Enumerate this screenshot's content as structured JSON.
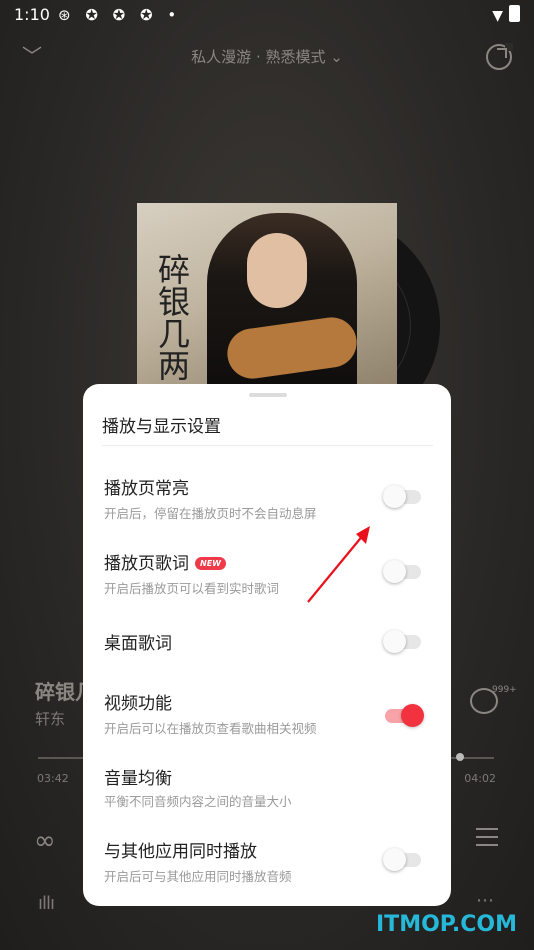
{
  "status_bar": {
    "time": "1:10",
    "notif_icons": "⊛ ✪ ✪ ✪ •"
  },
  "header": {
    "title": "私人漫游 · 熟悉模式 ⌄"
  },
  "album": {
    "calligraphy": "碎银几两"
  },
  "player": {
    "song_partial": "碎银几",
    "artist_partial": "轩东 ",
    "comment_count": "999+",
    "time_current": "03:42",
    "time_total": "04:02",
    "progress": 0.92
  },
  "settings_sheet": {
    "title": "播放与显示设置",
    "items": [
      {
        "label": "播放页常亮",
        "desc": "开启后，停留在播放页时不会自动息屏",
        "on": false
      },
      {
        "label": "播放页歌词",
        "badge": "NEW",
        "desc": "开启后播放页可以看到实时歌词",
        "on": false
      },
      {
        "label": "桌面歌词",
        "on": false
      },
      {
        "label": "视频功能",
        "desc": "开启后可以在播放页查看歌曲相关视频",
        "on": true
      },
      {
        "label": "音量均衡",
        "desc": "平衡不同音频内容之间的音量大小"
      },
      {
        "label": "与其他应用同时播放",
        "desc": "开启后可与其他应用同时播放音频",
        "on": false
      }
    ]
  },
  "watermark": "ITMOP.COM",
  "colors": {
    "accent": "#f2323f",
    "sheet": "#ffffff",
    "background": "#2e2c29",
    "watermark": "#26b8d8"
  }
}
